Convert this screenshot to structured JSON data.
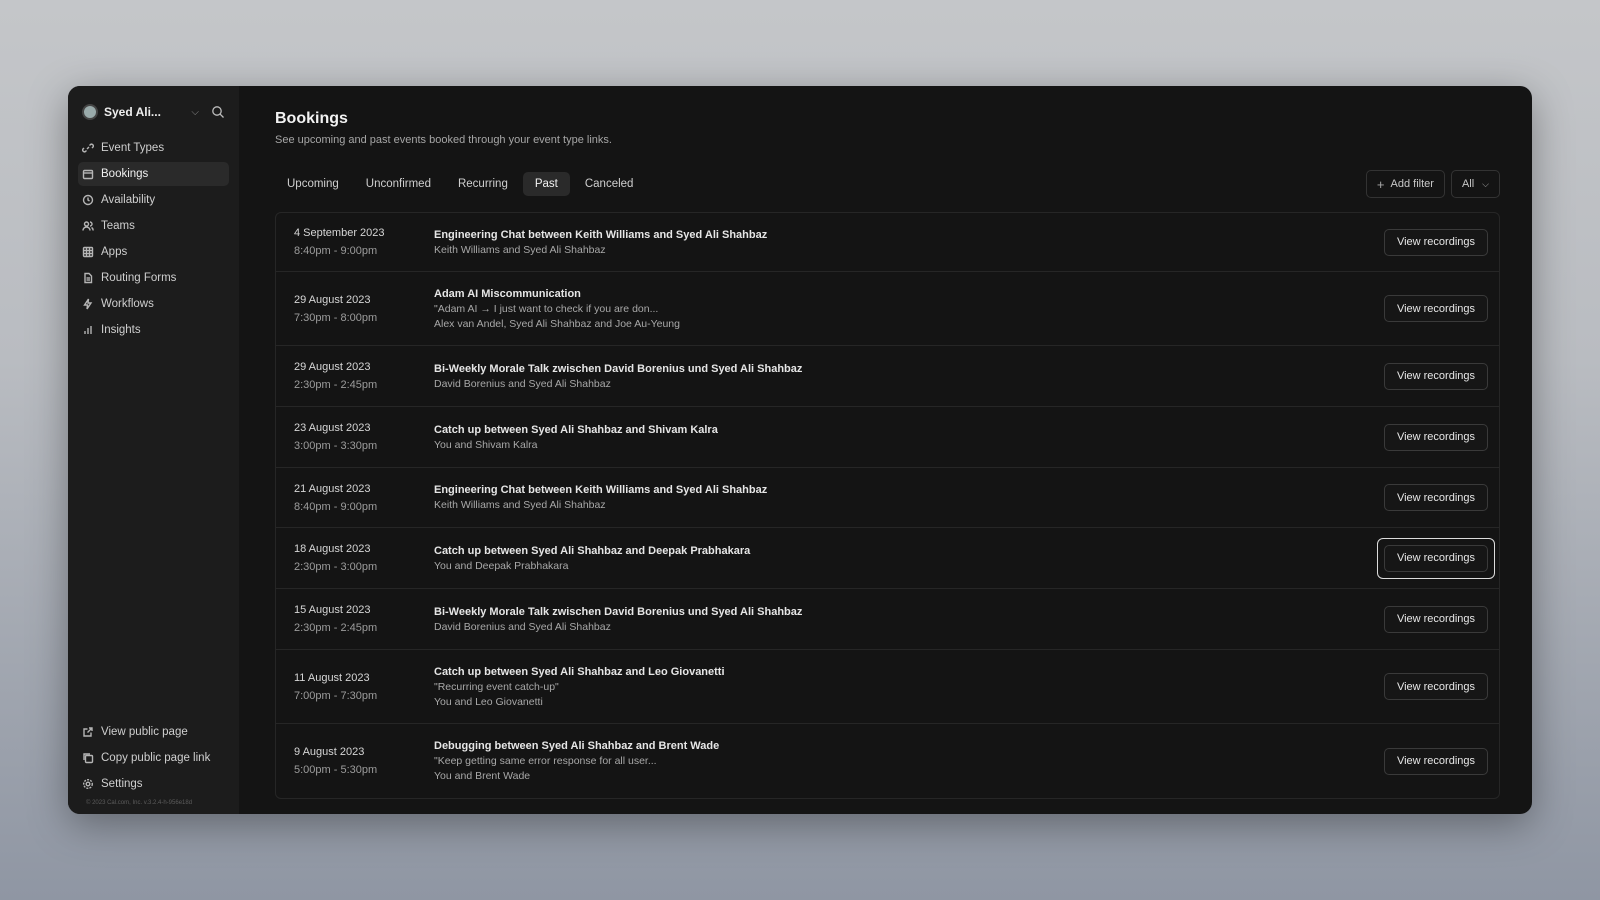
{
  "user": {
    "name": "Syed Ali..."
  },
  "nav": {
    "items": [
      {
        "label": "Event Types",
        "icon": "link-icon"
      },
      {
        "label": "Bookings",
        "icon": "calendar-icon",
        "active": true
      },
      {
        "label": "Availability",
        "icon": "clock-icon"
      },
      {
        "label": "Teams",
        "icon": "users-icon"
      },
      {
        "label": "Apps",
        "icon": "grid-icon"
      },
      {
        "label": "Routing Forms",
        "icon": "file-icon"
      },
      {
        "label": "Workflows",
        "icon": "zap-icon"
      },
      {
        "label": "Insights",
        "icon": "bar-chart-icon"
      }
    ],
    "bottom": [
      {
        "label": "View public page",
        "icon": "external-link-icon"
      },
      {
        "label": "Copy public page link",
        "icon": "copy-icon"
      },
      {
        "label": "Settings",
        "icon": "gear-icon"
      }
    ],
    "footer": "© 2023 Cal.com, Inc. v.3.2.4-h-956e18d"
  },
  "page": {
    "title": "Bookings",
    "subtitle": "See upcoming and past events booked through your event type links."
  },
  "tabs": [
    "Upcoming",
    "Unconfirmed",
    "Recurring",
    "Past",
    "Canceled"
  ],
  "active_tab": "Past",
  "filters": {
    "add_filter": "Add filter",
    "all": "All"
  },
  "bookings": [
    {
      "date": "4 September 2023",
      "time": "8:40pm - 9:00pm",
      "title": "Engineering Chat between Keith Williams and Syed Ali Shahbaz",
      "desc": "",
      "people": "Keith Williams and Syed Ali Shahbaz",
      "button": "View recordings"
    },
    {
      "date": "29 August 2023",
      "time": "7:30pm - 8:00pm",
      "title": "Adam AI Miscommunication",
      "desc": "\"Adam AI → I just want to check if you are don...",
      "people": "Alex van Andel, Syed Ali Shahbaz and Joe Au-Yeung",
      "button": "View recordings"
    },
    {
      "date": "29 August 2023",
      "time": "2:30pm - 2:45pm",
      "title": "Bi-Weekly Morale Talk zwischen David Borenius und Syed Ali Shahbaz",
      "desc": "",
      "people": "David Borenius and Syed Ali Shahbaz",
      "button": "View recordings"
    },
    {
      "date": "23 August 2023",
      "time": "3:00pm - 3:30pm",
      "title": "Catch up between Syed Ali Shahbaz and Shivam Kalra",
      "desc": "",
      "people": "You and Shivam Kalra",
      "button": "View recordings"
    },
    {
      "date": "21 August 2023",
      "time": "8:40pm - 9:00pm",
      "title": "Engineering Chat between Keith Williams and Syed Ali Shahbaz",
      "desc": "",
      "people": "Keith Williams and Syed Ali Shahbaz",
      "button": "View recordings"
    },
    {
      "date": "18 August 2023",
      "time": "2:30pm - 3:00pm",
      "title": "Catch up between Syed Ali Shahbaz and Deepak Prabhakara",
      "desc": "",
      "people": "You and Deepak Prabhakara",
      "button": "View recordings",
      "focused": true
    },
    {
      "date": "15 August 2023",
      "time": "2:30pm - 2:45pm",
      "title": "Bi-Weekly Morale Talk zwischen David Borenius und Syed Ali Shahbaz",
      "desc": "",
      "people": "David Borenius and Syed Ali Shahbaz",
      "button": "View recordings"
    },
    {
      "date": "11 August 2023",
      "time": "7:00pm - 7:30pm",
      "title": "Catch up between Syed Ali Shahbaz and Leo Giovanetti",
      "desc": "\"Recurring event catch-up\"",
      "people": "You and Leo Giovanetti",
      "button": "View recordings"
    },
    {
      "date": "9 August 2023",
      "time": "5:00pm - 5:30pm",
      "title": "Debugging between Syed Ali Shahbaz and Brent Wade",
      "desc": "\"Keep getting same error response for all user...",
      "people": "You and Brent Wade",
      "button": "View recordings"
    }
  ]
}
